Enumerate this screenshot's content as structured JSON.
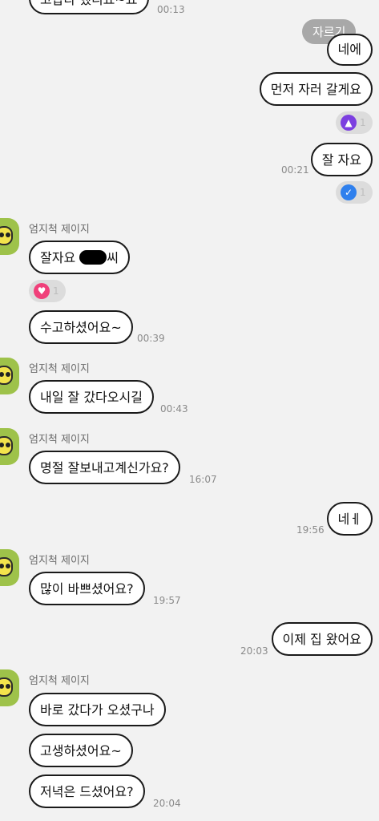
{
  "colors": {
    "background": "#f2f2f2",
    "bubble_bg": "#ffffff",
    "bubble_border": "#1a1a1a",
    "time_text": "#8a8a8a",
    "thumb_reaction": "#7c3fe0",
    "check_reaction": "#2f80ed",
    "heart_reaction": "#f0407a",
    "avatar_bg": "#9ec24a"
  },
  "overlay": {
    "cut_button": "자르기"
  },
  "messages": [
    {
      "text": "고맙다 했니요~요",
      "time": "00:13"
    },
    {
      "text": "네에"
    },
    {
      "text": "먼저 자러 갈게요"
    },
    {
      "reaction_icon": "thumbs-up-icon",
      "count": "1"
    },
    {
      "text": "잘 자요",
      "time": "00:21"
    },
    {
      "reaction_icon": "check-icon",
      "count": "1"
    },
    {
      "sender": "엄지척 제이지"
    },
    {
      "text_before": "잘자요",
      "text_after": "씨"
    },
    {
      "reaction_icon": "heart-icon",
      "count": "1"
    },
    {
      "text": "수고하셨어요~",
      "time": "00:39"
    },
    {
      "sender": "엄지척 제이지"
    },
    {
      "text": "내일 잘 갔다오시길",
      "time": "00:43"
    },
    {
      "sender": "엄지척 제이지"
    },
    {
      "text": "명절 잘보내고계신가요?",
      "time": "16:07"
    },
    {
      "text": "네ㅔ",
      "time": "19:56"
    },
    {
      "sender": "엄지척 제이지"
    },
    {
      "text": "많이 바쁘셨어요?",
      "time": "19:57"
    },
    {
      "text": "이제 집 왔어요",
      "time": "20:03"
    },
    {
      "sender": "엄지척 제이지"
    },
    {
      "text": "바로 갔다가 오셨구나"
    },
    {
      "text": "고생하셨어요~"
    },
    {
      "text": "저녁은 드셨어요?",
      "time": "20:04"
    }
  ]
}
